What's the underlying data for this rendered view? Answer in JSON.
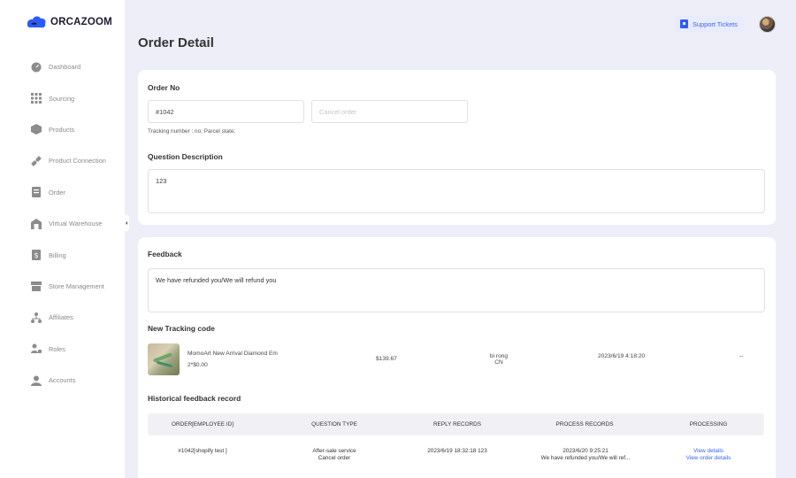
{
  "brand": {
    "name_part1": "ORCA",
    "name_part2": "ZOOM",
    "colors": {
      "mark": "#2d5bff",
      "accent": "#3b63ff"
    }
  },
  "sidebar": {
    "items": [
      {
        "label": "Dashboard",
        "icon": "dashboard-icon"
      },
      {
        "label": "Sourcing",
        "icon": "grid-icon"
      },
      {
        "label": "Products",
        "icon": "box-icon"
      },
      {
        "label": "Product Connection",
        "icon": "link-icon"
      },
      {
        "label": "Order",
        "icon": "order-icon"
      },
      {
        "label": "Virtual Warehouse",
        "icon": "warehouse-icon"
      },
      {
        "label": "Billing",
        "icon": "billing-icon"
      },
      {
        "label": "Store Management",
        "icon": "store-icon"
      },
      {
        "label": "Affiliates",
        "icon": "affiliates-icon"
      },
      {
        "label": "Roles",
        "icon": "roles-icon"
      },
      {
        "label": "Accounts",
        "icon": "account-icon"
      }
    ]
  },
  "header": {
    "support_label": "Support Tickets"
  },
  "page": {
    "title": "Order Detail"
  },
  "order": {
    "section_title": "Order No",
    "order_no": "#1042",
    "cancel_placeholder": "Cancel order",
    "tracking_info": "Tracking number : no; Parcel state;",
    "question_title": "Question Description",
    "question_text": "123"
  },
  "feedback": {
    "section_title": "Feedback",
    "text": "We have refunded you/We will refund you"
  },
  "tracking": {
    "section_title": "New Tracking code",
    "product_name": "MomoArt New Arrival Diamond Em",
    "quantity_price": "2*$0.00",
    "total": "$139.67",
    "recipient": "bi rong",
    "country": "CN",
    "datetime": "2023/6/19 4:18:20",
    "extra": "--"
  },
  "history": {
    "section_title": "Historical feedback record",
    "columns": [
      "ORDER[EMPLOYEE ID]",
      "QUESTION TYPE",
      "REPLY RECORDS",
      "PROCESS RECORDS",
      "PROCESSING"
    ],
    "rows": [
      {
        "order": "#1042[shopify test ]",
        "question_type_1": "After-sale service",
        "question_type_2": "Cancel order",
        "reply": "2023/6/19 18:32:18 123",
        "process_date": "2023/6/20 9:25:21",
        "process_text": "We have refunded you/We will ref...",
        "link_1": "View details",
        "link_2": "View order details"
      }
    ]
  }
}
